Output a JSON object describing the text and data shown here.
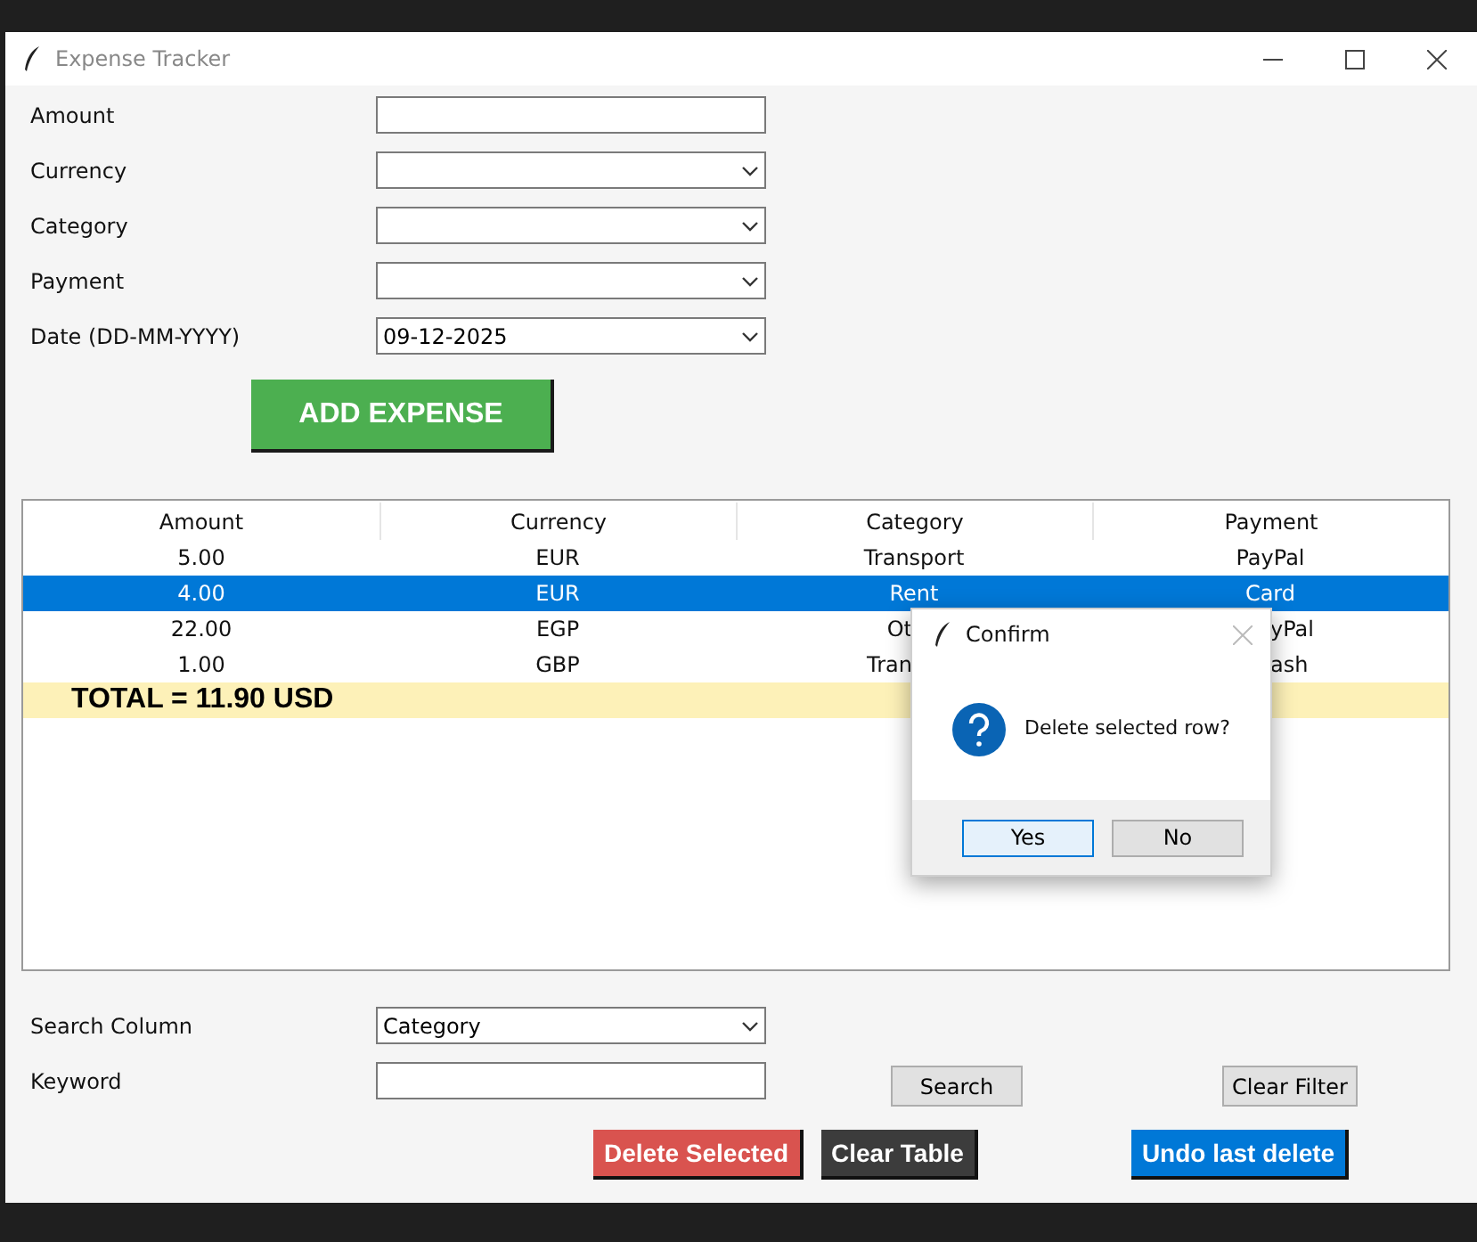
{
  "window": {
    "title": "Expense Tracker"
  },
  "form": [
    {
      "label": "Amount",
      "kind": "entry"
    },
    {
      "label": "Currency",
      "kind": "combo"
    },
    {
      "label": "Category",
      "kind": "combo"
    },
    {
      "label": "Payment",
      "kind": "combo"
    },
    {
      "label": "Date (DD-MM-YYYY)",
      "kind": "combo",
      "value": "09-12-2025"
    }
  ],
  "add_button": "ADD EXPENSE",
  "table": {
    "columns": [
      "Amount",
      "Currency",
      "Category",
      "Payment"
    ],
    "rows": [
      {
        "selected": false,
        "cells": [
          {
            "text": "5.00"
          },
          {
            "text": "EUR"
          },
          {
            "text": "Transport"
          },
          {
            "text": "PayPal"
          }
        ]
      },
      {
        "selected": true,
        "cells": [
          {
            "text": "4.00"
          },
          {
            "text": "EUR"
          },
          {
            "text": "Rent"
          },
          {
            "text": "Card"
          }
        ]
      },
      {
        "selected": false,
        "cells": [
          {
            "text": "22.00"
          },
          {
            "text": "EGP"
          },
          {
            "text": "Ot",
            "covered": true
          },
          {
            "text": "yPal",
            "covered": true
          }
        ]
      },
      {
        "selected": false,
        "cells": [
          {
            "text": "1.00"
          },
          {
            "text": "GBP"
          },
          {
            "text": "Tran",
            "covered": true
          },
          {
            "text": "ash",
            "covered": true
          }
        ]
      }
    ],
    "total": "TOTAL = 11.90 USD"
  },
  "search": [
    {
      "label": "Search Column",
      "kind": "combo",
      "value": "Category"
    },
    {
      "label": "Keyword",
      "kind": "entry"
    }
  ],
  "search_button": "Search",
  "clear_filter_button": "Clear Filter",
  "actions": [
    {
      "label": "Delete Selected",
      "color": "#d9534f"
    },
    {
      "label": "Clear Table",
      "color": "#3c3c3c"
    },
    {
      "label": "Undo last delete",
      "color": "#0078d7"
    }
  ],
  "dialog": {
    "title": "Confirm",
    "message": "Delete selected row?",
    "buttons": [
      {
        "label": "Yes",
        "selected": true
      },
      {
        "label": "No",
        "selected": false
      }
    ]
  }
}
